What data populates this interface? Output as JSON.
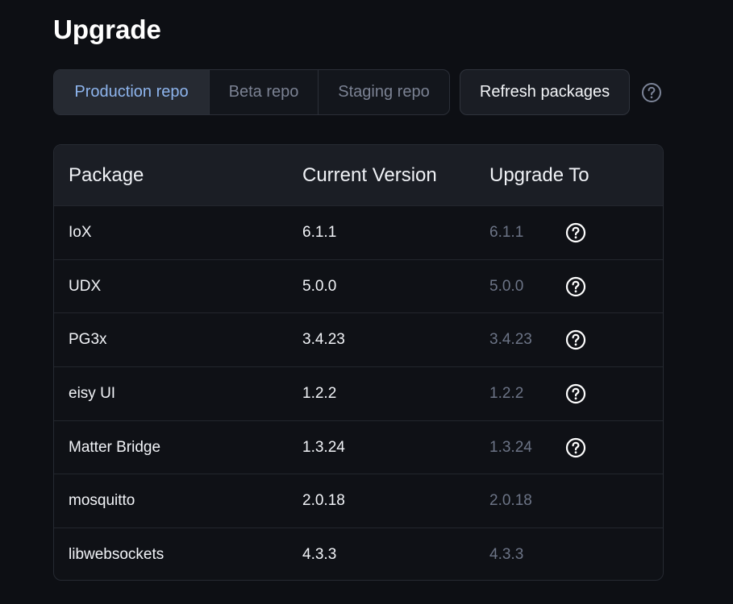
{
  "page": {
    "title": "Upgrade"
  },
  "toolbar": {
    "tabs": [
      {
        "label": "Production repo",
        "active": true
      },
      {
        "label": "Beta repo",
        "active": false
      },
      {
        "label": "Staging repo",
        "active": false
      }
    ],
    "refresh_label": "Refresh packages",
    "help_icon": "question-circle-icon"
  },
  "table": {
    "headers": {
      "package": "Package",
      "current": "Current Version",
      "upgrade": "Upgrade To"
    },
    "rows": [
      {
        "package": "IoX",
        "current": "6.1.1",
        "upgrade": "6.1.1",
        "help": true
      },
      {
        "package": "UDX",
        "current": "5.0.0",
        "upgrade": "5.0.0",
        "help": true
      },
      {
        "package": "PG3x",
        "current": "3.4.23",
        "upgrade": "3.4.23",
        "help": true
      },
      {
        "package": "eisy UI",
        "current": "1.2.2",
        "upgrade": "1.2.2",
        "help": true
      },
      {
        "package": "Matter Bridge",
        "current": "1.3.24",
        "upgrade": "1.3.24",
        "help": true
      },
      {
        "package": "mosquitto",
        "current": "2.0.18",
        "upgrade": "2.0.18",
        "help": false
      },
      {
        "package": "libwebsockets",
        "current": "4.3.3",
        "upgrade": "4.3.3",
        "help": false
      }
    ]
  },
  "colors": {
    "background": "#0d0f14",
    "active_tab_text": "#8eb5ee",
    "muted_text": "#6c7486"
  }
}
